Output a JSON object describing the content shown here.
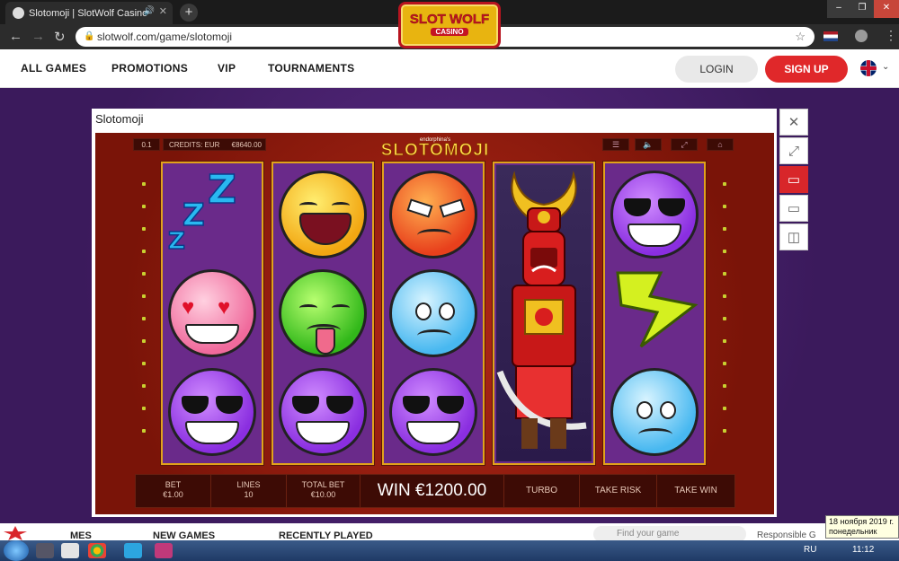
{
  "browser": {
    "tab_title": "Slotomoji | SlotWolf Casino",
    "url": "slotwolf.com/game/slotomoji",
    "new_tab": "+",
    "window_buttons": {
      "minimize": "‒",
      "maximize": "❐",
      "close": "✕"
    }
  },
  "site_nav": {
    "items": [
      "ALL GAMES",
      "PROMOTIONS",
      "VIP",
      "TOURNAMENTS"
    ],
    "logo_line1": "SLOT WOLF",
    "logo_line2": "CASINO",
    "login": "LOGIN",
    "signup": "SIGN UP"
  },
  "game_window": {
    "title": "Slotomoji",
    "top_bar": {
      "bet_level": "0.1",
      "credits_label": "CREDITS: EUR",
      "credits_value": "€8640.00",
      "logo_sub": "endorphina's",
      "logo_main": "SLOTOMOJI"
    },
    "bottom_bar": {
      "bet_label": "BET",
      "bet_value": "€1.00",
      "lines_label": "LINES",
      "lines_value": "10",
      "total_bet_label": "TOTAL BET",
      "total_bet_value": "€10.00",
      "win_text": "WIN €1200.00",
      "turbo": "TURBO",
      "take_risk": "TAKE RISK",
      "take_win": "TAKE WIN"
    },
    "reels": [
      [
        "zzz",
        "heart-eyes",
        "sunglasses"
      ],
      [
        "laughing",
        "sick",
        "sunglasses"
      ],
      [
        "angry",
        "crying",
        "sunglasses"
      ],
      [
        "samurai-wild"
      ],
      [
        "sunglasses",
        "lightning",
        "crying"
      ]
    ]
  },
  "side_panel": [
    "close-icon",
    "fullscreen-icon",
    "monitor-icon",
    "monitor-icon",
    "monitor-split-icon"
  ],
  "lower_strip": {
    "items": [
      "MES",
      "NEW GAMES",
      "RECENTLY PLAYED"
    ],
    "search_placeholder": "Find your game",
    "responsible": "Responsible G"
  },
  "tooltip": {
    "line1": "18 ноября 2019 г.",
    "line2": "понедельник"
  },
  "taskbar": {
    "lang": "RU",
    "time": "11:12"
  }
}
